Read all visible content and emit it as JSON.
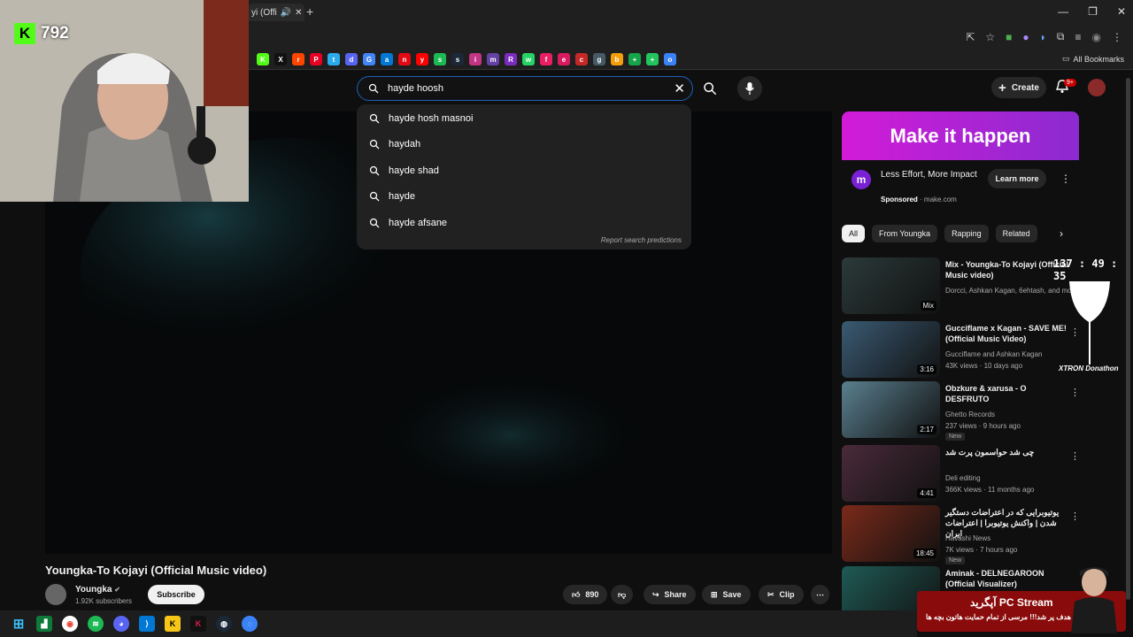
{
  "browser": {
    "tab_title": "yi (Offi",
    "all_bookmarks": "All Bookmarks",
    "bookmarks": [
      {
        "label": "K",
        "color": "#53fc18"
      },
      {
        "label": "X",
        "color": "#111111"
      },
      {
        "label": "r",
        "color": "#ff4500"
      },
      {
        "label": "P",
        "color": "#e60023"
      },
      {
        "label": "t",
        "color": "#2aabee"
      },
      {
        "label": "d",
        "color": "#5865f2"
      },
      {
        "label": "G",
        "color": "#4285f4"
      },
      {
        "label": "a",
        "color": "#0078d4"
      },
      {
        "label": "n",
        "color": "#e50914"
      },
      {
        "label": "y",
        "color": "#ff0000"
      },
      {
        "label": "s",
        "color": "#1db954"
      },
      {
        "label": "s",
        "color": "#1b2838"
      },
      {
        "label": "i",
        "color": "#c13584"
      },
      {
        "label": "m",
        "color": "#6441a5"
      },
      {
        "label": "R",
        "color": "#7b2cbf"
      },
      {
        "label": "w",
        "color": "#25d366"
      },
      {
        "label": "f",
        "color": "#e91e63"
      },
      {
        "label": "e",
        "color": "#d81b60"
      },
      {
        "label": "c",
        "color": "#c62828"
      },
      {
        "label": "g",
        "color": "#455a64"
      },
      {
        "label": "b",
        "color": "#f59e0b"
      },
      {
        "label": "+",
        "color": "#16a34a"
      },
      {
        "label": "+",
        "color": "#22c55e"
      },
      {
        "label": "o",
        "color": "#3b82f6"
      }
    ]
  },
  "header": {
    "search_value": "hayde hoosh",
    "create_label": "Create",
    "notif_count": "9+"
  },
  "suggestions": {
    "items": [
      "hayde hosh masnoi",
      "haydah",
      "hayde shad",
      "hayde",
      "hayde afsane"
    ],
    "report": "Report search predictions"
  },
  "video": {
    "title": "Youngka-To Kojayi (Official Music video)",
    "channel": "Youngka",
    "subscribers": "1.92K subscribers",
    "subscribe_label": "Subscribe",
    "likes": "890",
    "share_label": "Share",
    "save_label": "Save",
    "clip_label": "Clip"
  },
  "ad": {
    "banner": "Make it happen",
    "headline": "Less Effort, More Impact",
    "sponsored": "Sponsored",
    "domain": "make.com",
    "cta": "Learn more"
  },
  "chips": [
    "All",
    "From Youngka",
    "Rapping",
    "Related"
  ],
  "recommendations": [
    {
      "title": "Mix - Youngka-To Kojayi (Official Music video)",
      "meta1": "Dorcci, Ashkan Kagan, 6ehtash, and more",
      "meta2": "",
      "badge": "Mix",
      "new": "",
      "thumb": "#2b3a3a"
    },
    {
      "title": "Gucciflame x Kagan - SAVE ME! (Official Music Video)",
      "meta1": "Gucciflame and Ashkan Kagan",
      "meta2": "43K views · 10 days ago",
      "badge": "3:16",
      "new": "",
      "thumb": "#3a5a72"
    },
    {
      "title": "Obzkure & xarusa - O DESFRUTO",
      "meta1": "Ghetto Records",
      "meta2": "237 views · 9 hours ago",
      "badge": "2:17",
      "new": "New",
      "thumb": "#5a7f8f"
    },
    {
      "title": "چی شد حواسمون پرت شد",
      "meta1": "Deli editing",
      "meta2": "366K views · 11 months ago",
      "badge": "4:41",
      "new": "",
      "thumb": "#4a2a3a"
    },
    {
      "title": "یوتیوبرایی که در اعتراضات دستگیر شدن | واکنش یوتیوبرا | اعتراضات ایران",
      "meta1": "Havashi News",
      "meta2": "7K views · 7 hours ago",
      "badge": "18:45",
      "new": "New",
      "thumb": "#7a2a1a"
    },
    {
      "title": "Aminak - DELNEGAROON (Official Visualizer)",
      "meta1": "",
      "meta2": "",
      "badge": "",
      "new": "",
      "thumb": "#1f5a55"
    }
  ],
  "overlays": {
    "kick_count": "792",
    "timer": "137 : 49 : 35",
    "donathon": "XTRON Donathon",
    "promo_title": "آپگرید PC Stream",
    "promo_sub": "هدف پر شد!!! مرسی از تمام حمایت هاتون بچه ها"
  }
}
